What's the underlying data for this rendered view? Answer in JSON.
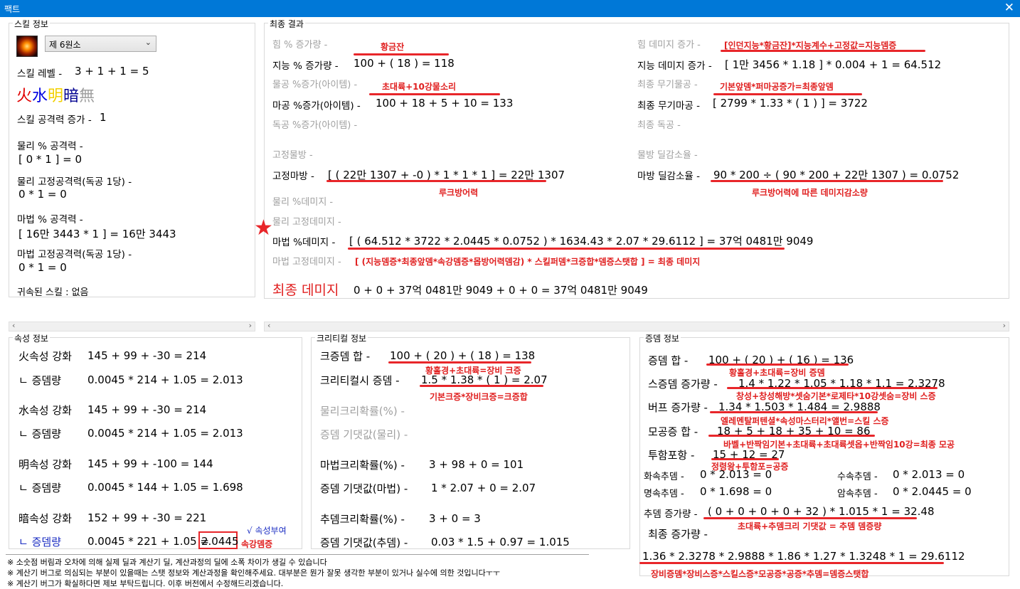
{
  "window": {
    "title": "팩트",
    "close": "✕"
  },
  "skill": {
    "group": "스킬 정보",
    "combo": "제 6원소",
    "level_label": "스킬 레벨 -",
    "level_value": "3 + 1 + 1 = 5",
    "elements": [
      {
        "char": "火",
        "color": "#e00000"
      },
      {
        "char": "水",
        "color": "#0000e0"
      },
      {
        "char": "明",
        "color": "#f2d000"
      },
      {
        "char": "暗",
        "color": "#000090"
      },
      {
        "char": "無",
        "color": "#a0a0a0"
      }
    ],
    "atk_inc_label": "스킬 공격력 증가 -",
    "atk_inc_value": "1",
    "phys_pct_label": "물리 % 공격력 -",
    "phys_pct_value": "[ 0 * 1 ] = 0",
    "phys_fixed_label": "물리 고정공격력(독공 1당) -",
    "phys_fixed_value": "0 * 1 = 0",
    "mag_pct_label": "마법 % 공격력 -",
    "mag_pct_value": "[ 16만 3443 * 1 ] = 16만 3443",
    "mag_fixed_label": "마법 고정공격력(독공 1당) -",
    "mag_fixed_value": "0 * 1 = 0",
    "bound_label": "귀속된 스킬 : 없음"
  },
  "final": {
    "group": "최종 결과",
    "str_pct": "힘 % 증가량 -",
    "int_pct_label": "지능 % 증가량 -",
    "int_pct_value": "100 + ( 18 ) = 118",
    "note_int": "황금잔",
    "patk_item": "물공 %증가(아이템) -",
    "matk_item_label": "마공 %증가(아이템) -",
    "matk_item_value": "100 + 18 + 5 + 10 = 133",
    "note_matk": "초대륙+10강물소리",
    "indep_item": "독공 %증가(아이템) -",
    "fixed_pdef": "고정물방 -",
    "fixed_mdef_label": "고정마방 -",
    "fixed_mdef_value": "[ ( 22만 1307 + -0 ) * 1 * 1 * 1 ] = 22만 1307",
    "note_luke": "루크방어력",
    "pdmg_pct": "물리 %데미지 -",
    "pdmg_fixed": "물리 고정데미지 -",
    "mdmg_pct_label": "마법 %데미지 -",
    "mdmg_pct_value": "[ ( 64.512 * 3722 * 2.0445 * 0.0752 ) * 1634.43 * 2.07 * 29.6112 ] = 37억 0481만 9049",
    "mdmg_fixed": "마법 고정데미지 -",
    "note_formula": "[ (지능뎀증*최종앞뎀*속강뎀증*몹방어력뎀감) * 스킬퍼뎀*크증합*뎀증스탯합 ] = 최종 데미지",
    "final_label": "최종 데미지",
    "final_value": "0 + 0 + 37억 0481만 9049 + 0 + 0 = 37억 0481만 9049",
    "str_dmg": "힘 데미지 증가 -",
    "note_int_dmg": "[인던지능*황금잔]*지능계수+고정값=지능뎀증",
    "int_dmg_label": "지능 데미지 증가 -",
    "int_dmg_value": "[ 1만 3456 * 1.18 ] * 0.004 + 1 = 64.512",
    "final_patk": "최종 무기물공 -",
    "note_weapon": "기본앞뎀*퍼마공증가=최종앞뎀",
    "final_matk_label": "최종 무기마공 -",
    "final_matk_value": "[ 2799 * 1.33 * ( 1 ) ] = 3722",
    "final_indep": "최종 독공 -",
    "pdef_reduce": "물방 딜감소율 -",
    "mdef_reduce_label": "마방 딜감소율 -",
    "mdef_reduce_value": "90 * 200 ÷ ( 90 * 200 + 22만 1307 ) = 0.0752",
    "note_reduce": "루크방어력에 따른 데미지감소량"
  },
  "attr": {
    "group": "속성 정보",
    "fire_label": "火속성 강화",
    "fire_value": "145 + 99 + -30 = 214",
    "fire_inc_label": "ㄴ 증뎀량",
    "fire_inc_value": "0.0045 * 214 + 1.05 = 2.013",
    "water_label": "水속성 강화",
    "water_value": "145 + 99 + -30 = 214",
    "water_inc_label": "ㄴ 증뎀량",
    "water_inc_value": "0.0045 * 214 + 1.05 = 2.013",
    "light_label": "明속성 강화",
    "light_value": "145 + 99 + -100 = 144",
    "light_inc_label": "ㄴ 증뎀량",
    "light_inc_value": "0.0045 * 144 + 1.05 = 1.698",
    "dark_label": "暗속성 강화",
    "dark_value": "152 + 99 + -30 = 221",
    "dark_inc_label": "ㄴ 증뎀량",
    "dark_inc_value": "0.0045 * 221 + 1.05 = ",
    "dark_inc_result": "2.0445",
    "attr_given": "√ 속성부여",
    "note_dark": "속강뎀증"
  },
  "crit": {
    "group": "크리티컬 정보",
    "sum_label": "크증뎀 합 -",
    "sum_value": "100 + ( 20 ) + ( 18 ) = 138",
    "note_sum": "황홀경+초대륙=장비 크증",
    "crit_inc_label": "크리티컬시 증뎀 -",
    "crit_inc_value": "1.5 * 1.38 * ( 1 ) = 2.07",
    "note_crit": "기본크증*장비크증=크증합",
    "pcrit_rate": "물리크리확률(%) -",
    "pexpect": "증뎀 기댓값(물리) -",
    "mcrit_label": "마법크리확률(%) -",
    "mcrit_value": "3 + 98 + 0 = 101",
    "mexpect_label": "증뎀 기댓값(마법) -",
    "mexpect_value": "1 * 2.07 + 0 = 2.07",
    "acrit_label": "추뎀크리확률(%) -",
    "acrit_value": "3 + 0 = 3",
    "aexpect_label": "증뎀 기댓값(추뎀) -",
    "aexpect_value": "0.03 * 1.5 + 0.97 = 1.015"
  },
  "inc": {
    "group": "증뎀 정보",
    "sum_label": "증뎀 합 -",
    "sum_value": "100 + ( 20 ) + ( 16 ) = 136",
    "note_sum": "황홀경+초대륙=장비 증뎀",
    "skill_label": "스증뎀 증가량 -",
    "skill_value": "1.4 * 1.22 * 1.05 * 1.18 * 1.1 = 2.3278",
    "note_skill": "창성+창성해방*셋숨기본*로제타*10강셋숨=장비 스증",
    "buff_label": "버프 증가량 -",
    "buff_value": "1.34 * 1.503 * 1.484 = 2.9888",
    "note_buff": "엘레멘탈퍼텐셜*속성마스터리*앨번=스킬 스증",
    "allatk_label": "모공증 합 -",
    "allatk_value": "18 + 5 + 18 + 35 + 10 = 86",
    "note_allatk": "바벨+반짝임기본+초대륙+초대륙셋옵+반짝임10강=최종 모공",
    "pen_label": "투함포항 -",
    "pen_value": "15 + 12 = 27",
    "note_pen": "정령왕+투함포=공증",
    "fire_add_label": "화속추뎀 -",
    "fire_add_value": "0 * 2.013 = 0",
    "water_add_label": "수속추뎀 -",
    "water_add_value": "0 * 2.013 = 0",
    "light_add_label": "명속추뎀 -",
    "light_add_value": "0 * 1.698 = 0",
    "dark_add_label": "암속추뎀 -",
    "dark_add_value": "0 * 2.0445 = 0",
    "add_label": "추뎀 증가량 -",
    "add_value": "( 0 + 0 + 0 + 0 + 32 ) * 1.015 * 1 = 32.48",
    "note_add": "초대륙+추뎀크리 기댓값 = 추뎀 뎀증량",
    "final_label": "최종 증가량 -",
    "final_value": "1.36 * 2.3278 * 2.9888 * 1.86 * 1.27 * 1.3248 * 1 = 29.6112",
    "note_final": "장비증뎀*장비스증*스킬스증*모공증*공증*추뎀=뎀증스탯합"
  },
  "footer": [
    "※ 소숫점 버림과 오차에 의해 실제 딜과 계산기 딜, 계산과정의 딜에 소폭 차이가 생길 수 있습니다",
    "※ 계산기 버그로 의심되는 부분이 있을때는 스탯 정보와 계산과정을 확인해주세요. 대부분은 뭔가 잘못 생각한 부분이 있거나 실수에 의한 것입니다ㅜㅜ",
    "※ 계산기 버그가 확실하다면 제보 부탁드립니다. 이후 버전에서 수정해드리겠습니다."
  ]
}
